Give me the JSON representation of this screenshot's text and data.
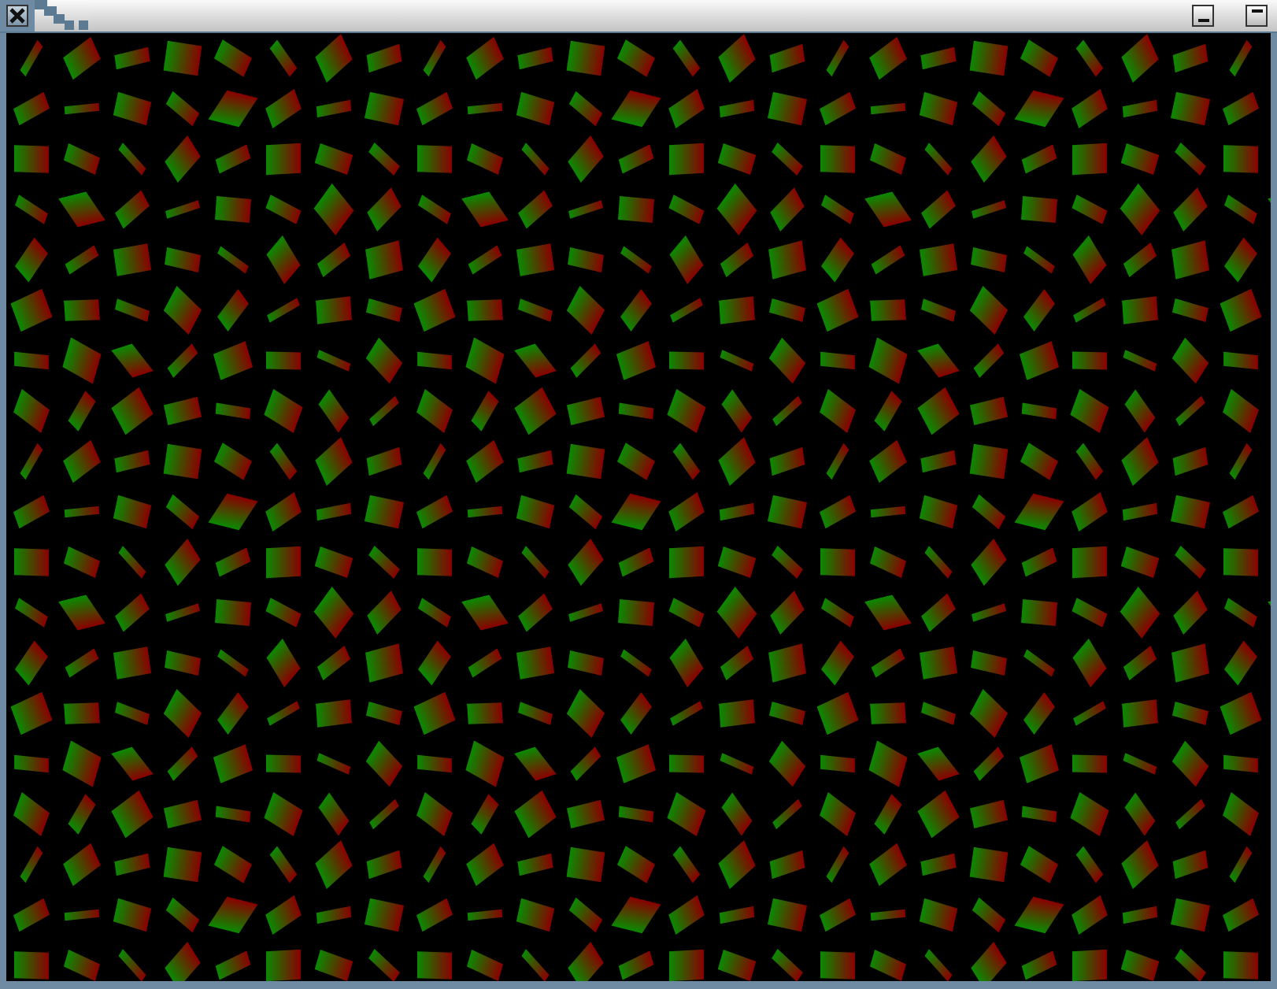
{
  "window": {
    "title_bar": {
      "buttons": [
        {
          "kind": "close"
        },
        {
          "kind": "minimize"
        },
        {
          "kind": "maximize"
        }
      ]
    }
  },
  "canvas": {
    "kind": "quad-grid"
  }
}
